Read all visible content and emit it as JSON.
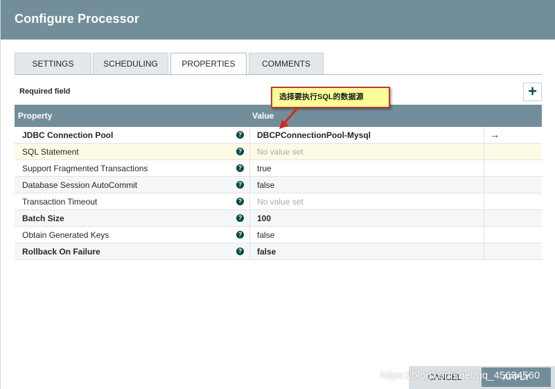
{
  "header": {
    "title": "Configure Processor"
  },
  "tabs": [
    {
      "label": "SETTINGS"
    },
    {
      "label": "SCHEDULING"
    },
    {
      "label": "PROPERTIES"
    },
    {
      "label": "COMMENTS"
    }
  ],
  "required_label": "Required field",
  "add_icon": "+",
  "table": {
    "headers": {
      "property": "Property",
      "value": "Value"
    },
    "rows": [
      {
        "name": "JDBC Connection Pool",
        "value": "DBCPConnectionPool-Mysql"
      },
      {
        "name": "SQL Statement",
        "value": "No value set"
      },
      {
        "name": "Support Fragmented Transactions",
        "value": "true"
      },
      {
        "name": "Database Session AutoCommit",
        "value": "false"
      },
      {
        "name": "Transaction Timeout",
        "value": "No value set"
      },
      {
        "name": "Batch Size",
        "value": "100"
      },
      {
        "name": "Obtain Generated Keys",
        "value": "false"
      },
      {
        "name": "Rollback On Failure",
        "value": "false"
      }
    ],
    "help_glyph": "?",
    "goto_glyph": "→"
  },
  "annotation": {
    "text": "选择要执行SQL的数据源"
  },
  "footer": {
    "cancel": "CANCEL",
    "apply": "APPLY"
  },
  "watermark": "https://blog.csdn.net/qq_45634560",
  "colors": {
    "header": "#728e9b",
    "accent": "#004849",
    "callout_fill": "#ffff9a",
    "callout_border": "#c0392b"
  }
}
